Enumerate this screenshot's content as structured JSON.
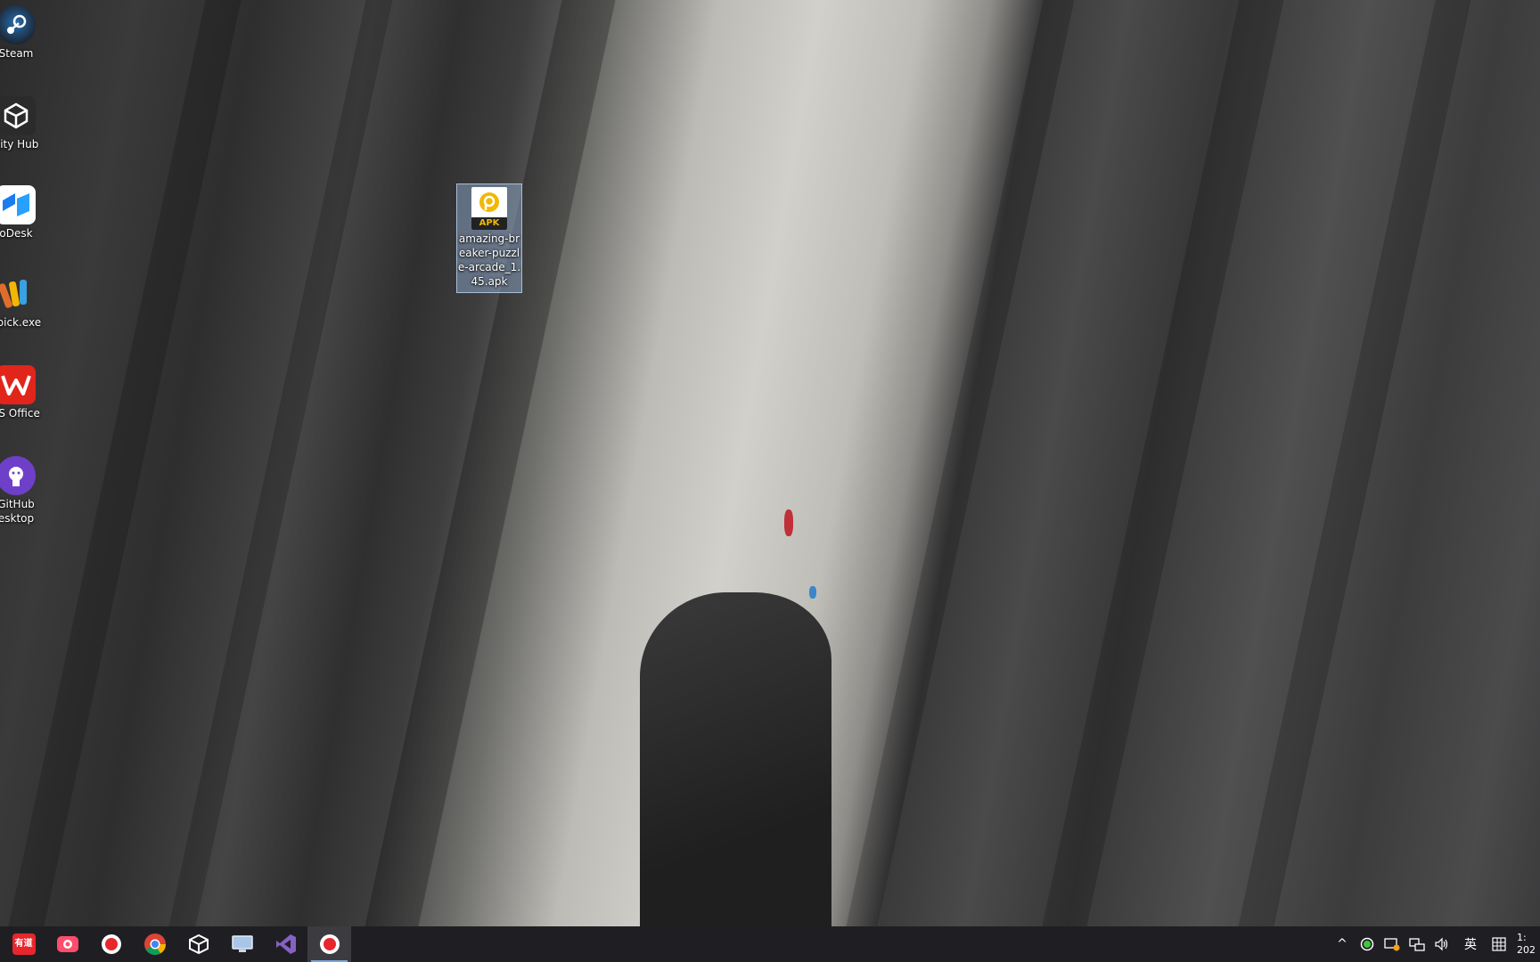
{
  "desktop_icons": [
    {
      "label": "Steam",
      "icon": "steam-icon",
      "color": "#1b2838"
    },
    {
      "label": "nity Hub",
      "icon": "unity-hub-icon",
      "color": "#2b2b2b"
    },
    {
      "label": "oDesk",
      "icon": "todesk-icon",
      "color": "#1a7cf0"
    },
    {
      "label": "cpick.exe",
      "icon": "colorpick-icon",
      "color": "#e06d2c"
    },
    {
      "label": "PS Office",
      "icon": "wps-office-icon",
      "color": "#e1251b"
    },
    {
      "label": "GitHub\nesktop",
      "icon": "github-desktop-icon",
      "color": "#6e40c9"
    }
  ],
  "selected_file": {
    "badge": "APK",
    "label": "amazing-breaker-puzzle-arcade_1.45.apk",
    "label_lines": [
      "amazing-br",
      "eaker-puzzl",
      "e-arcade_1.",
      "45.apk"
    ],
    "icon": "apk-file-icon",
    "color": "#f2b705"
  },
  "taskbar": {
    "apps": [
      {
        "name": "youdao-dictionary",
        "icon": "youdao-icon",
        "label": "有道",
        "color": "#e8262d",
        "active": false
      },
      {
        "name": "screen-recorder",
        "icon": "camera-icon",
        "label": "",
        "color": "#ff4d6d",
        "active": false
      },
      {
        "name": "recorder-1",
        "icon": "record-icon",
        "label": "",
        "color": "#e8262d",
        "active": false
      },
      {
        "name": "chrome",
        "icon": "chrome-icon",
        "label": "",
        "color": "#4285f4",
        "active": false
      },
      {
        "name": "unity",
        "icon": "unity-icon",
        "label": "",
        "color": "#ffffff",
        "active": false
      },
      {
        "name": "file-explorer",
        "icon": "monitor-icon",
        "label": "",
        "color": "#a9c6e8",
        "active": false
      },
      {
        "name": "visual-studio",
        "icon": "visual-studio-icon",
        "label": "",
        "color": "#8661c5",
        "active": false
      },
      {
        "name": "recorder-2",
        "icon": "record-icon",
        "label": "",
        "color": "#e8262d",
        "active": true
      }
    ],
    "tray": {
      "chevron": "^",
      "ime": "英",
      "clock_time": "1:",
      "clock_date": "202"
    }
  }
}
